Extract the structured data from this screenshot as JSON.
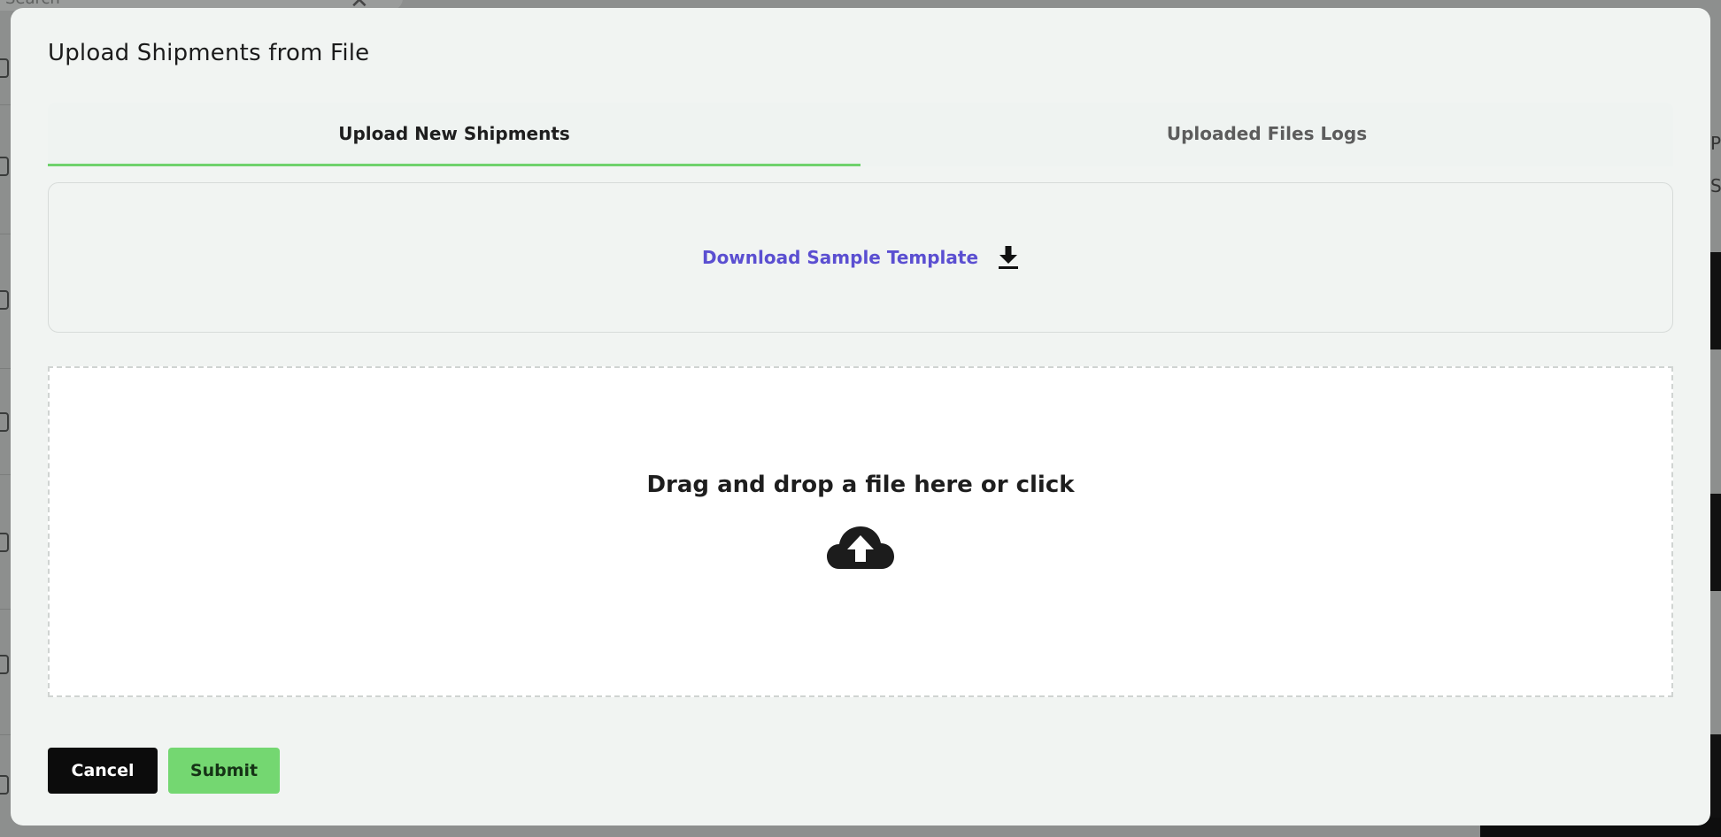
{
  "background": {
    "search_placeholder": "Search",
    "right_text_1": "P",
    "right_text_2": "S"
  },
  "modal": {
    "title": "Upload Shipments from File",
    "tabs": [
      {
        "label": "Upload New Shipments",
        "active": true
      },
      {
        "label": "Uploaded Files Logs",
        "active": false
      }
    ],
    "template": {
      "link_label": "Download Sample Template",
      "icon": "download-icon"
    },
    "dropzone": {
      "text": "Drag and drop a file here or click",
      "icon": "cloud-upload-icon"
    },
    "buttons": {
      "cancel_label": "Cancel",
      "submit_label": "Submit"
    }
  },
  "colors": {
    "accent_green": "#74d771",
    "link_purple": "#5b4fd1",
    "active_tab_underline": "#6fd16c"
  }
}
